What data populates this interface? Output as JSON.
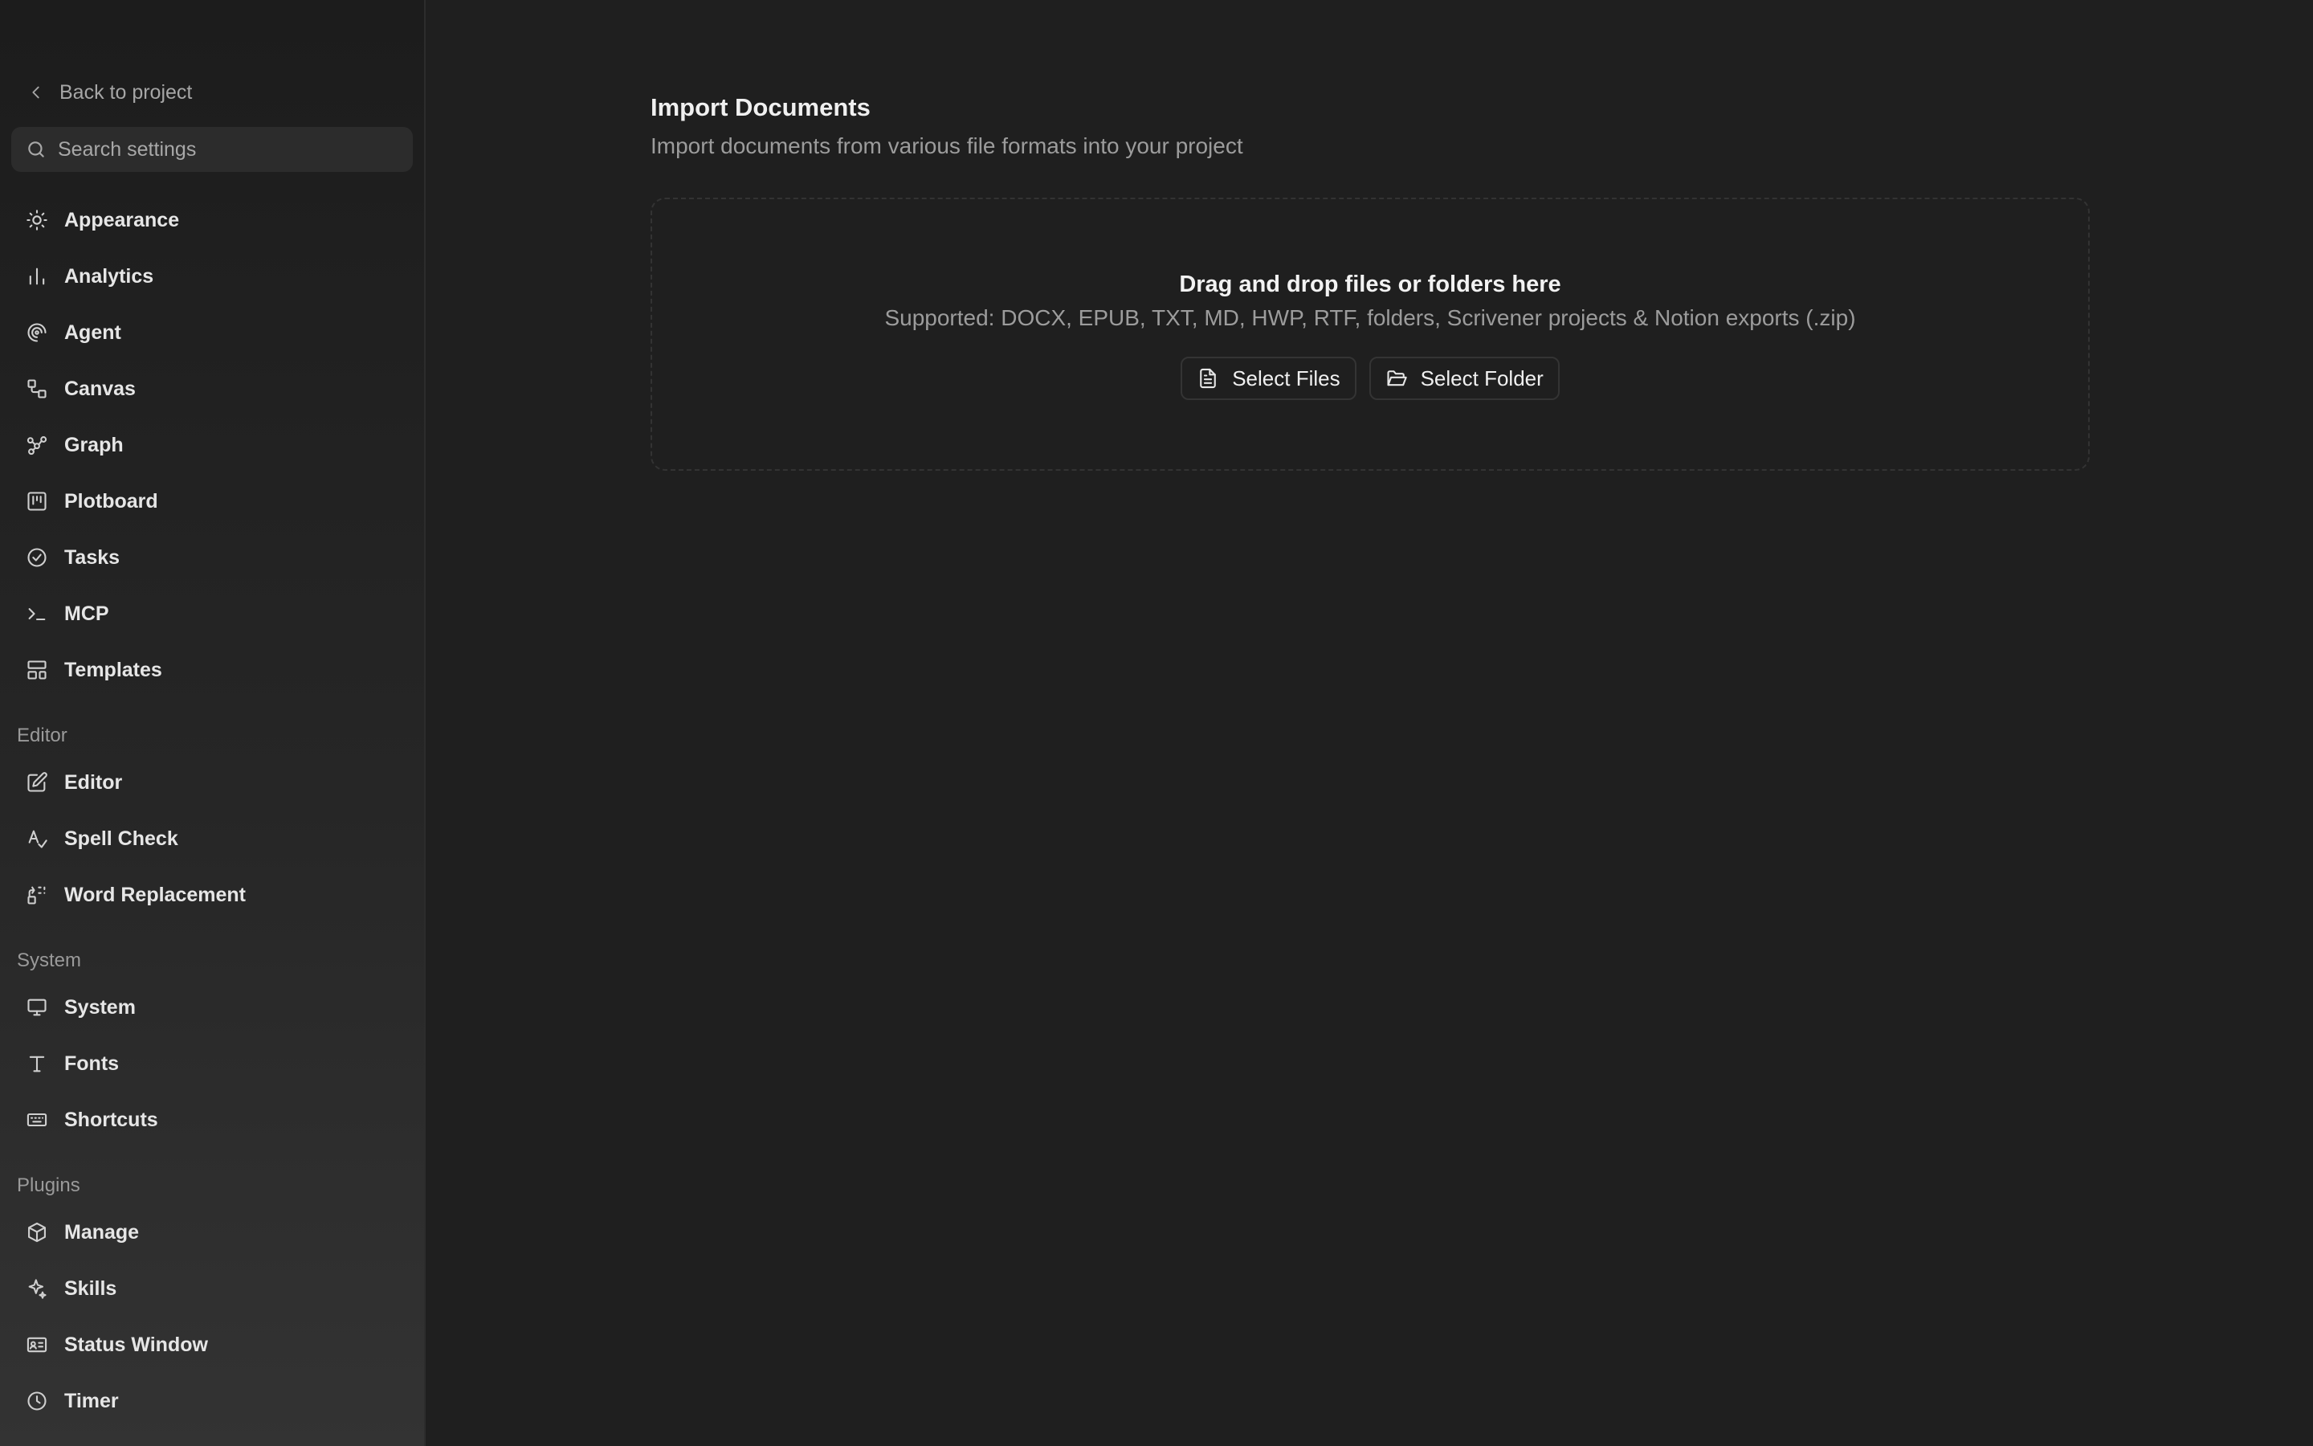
{
  "sidebar": {
    "back_label": "Back to project",
    "search_placeholder": "Search settings",
    "items": [
      {
        "label": "Appearance",
        "icon": "sun-icon"
      },
      {
        "label": "Analytics",
        "icon": "bar-chart-icon"
      },
      {
        "label": "Agent",
        "icon": "spiral-icon"
      },
      {
        "label": "Canvas",
        "icon": "canvas-icon"
      },
      {
        "label": "Graph",
        "icon": "graph-icon"
      },
      {
        "label": "Plotboard",
        "icon": "kanban-icon"
      },
      {
        "label": "Tasks",
        "icon": "check-circle-icon"
      },
      {
        "label": "MCP",
        "icon": "terminal-icon"
      },
      {
        "label": "Templates",
        "icon": "layout-template-icon"
      }
    ],
    "sections": [
      {
        "label": "Editor",
        "items": [
          {
            "label": "Editor",
            "icon": "pencil-square-icon"
          },
          {
            "label": "Spell Check",
            "icon": "spell-check-icon"
          },
          {
            "label": "Word Replacement",
            "icon": "replace-icon"
          }
        ]
      },
      {
        "label": "System",
        "items": [
          {
            "label": "System",
            "icon": "monitor-icon"
          },
          {
            "label": "Fonts",
            "icon": "type-icon"
          },
          {
            "label": "Shortcuts",
            "icon": "keyboard-icon"
          }
        ]
      },
      {
        "label": "Plugins",
        "items": [
          {
            "label": "Manage",
            "icon": "package-icon"
          },
          {
            "label": "Skills",
            "icon": "sparkle-icon"
          },
          {
            "label": "Status Window",
            "icon": "id-card-icon"
          },
          {
            "label": "Timer",
            "icon": "clock-icon"
          }
        ]
      }
    ]
  },
  "main": {
    "title": "Import Documents",
    "subtitle": "Import documents from various file formats into your project",
    "dropzone": {
      "title": "Drag and drop files or folders here",
      "supported": "Supported: DOCX, EPUB, TXT, MD, HWP, RTF, folders, Scrivener projects & Notion exports (.zip)",
      "select_files_label": "Select Files",
      "select_folder_label": "Select Folder"
    }
  },
  "colors": {
    "background": "#1f1f1f",
    "sidebar_top": "#1c1c1c",
    "sidebar_bottom": "#333333",
    "text_primary": "#e6e6e6",
    "text_muted": "#9c9c9c"
  }
}
